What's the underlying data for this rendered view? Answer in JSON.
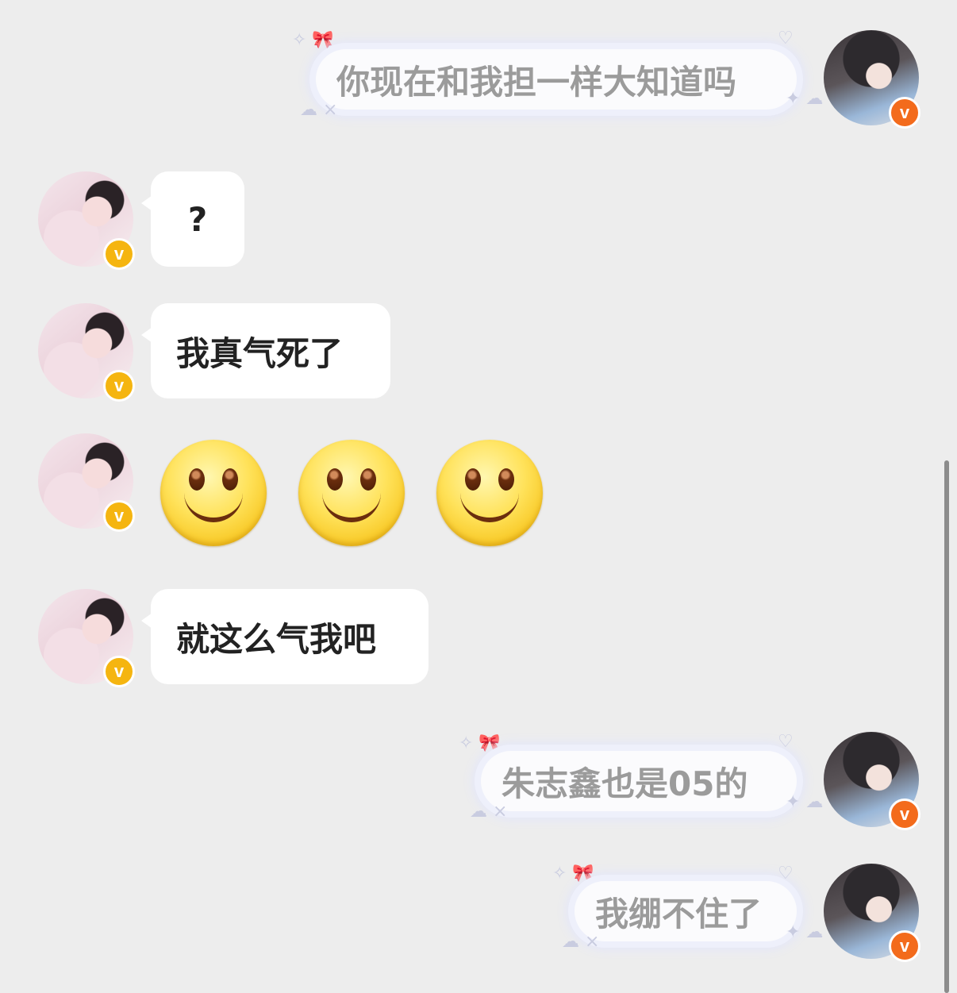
{
  "messages": [
    {
      "side": "me",
      "text": "你现在和我担一样大知道吗"
    },
    {
      "side": "peer",
      "text": "?"
    },
    {
      "side": "peer",
      "text": "我真气死了"
    },
    {
      "side": "peer",
      "emoji": [
        "smile",
        "smile",
        "smile"
      ]
    },
    {
      "side": "peer",
      "text": "就这么气我吧"
    },
    {
      "side": "me",
      "text": "朱志鑫也是05的"
    },
    {
      "side": "me",
      "text": "我绷不住了"
    }
  ],
  "badge": {
    "letter": "v"
  },
  "colors": {
    "background": "#ededed",
    "peer_badge": "#f5b510",
    "me_badge": "#f36b1c"
  },
  "icons": {
    "emoji": "smile-emoji-icon",
    "badge": "verified-v-icon"
  }
}
